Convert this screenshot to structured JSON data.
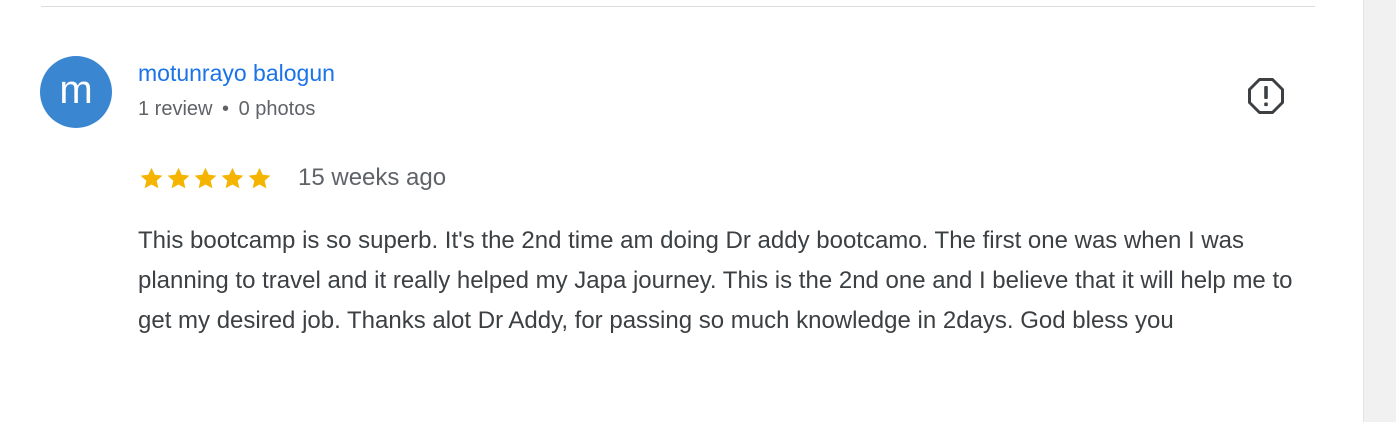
{
  "review": {
    "avatar_letter": "m",
    "avatar_color": "#3b86d1",
    "reviewer_name": "motunrayo balogun",
    "review_count": "1 review",
    "meta_separator": "•",
    "photo_count": "0 photos",
    "rating": 5,
    "rating_max": 5,
    "star_color": "#f4b400",
    "time_ago": "15 weeks ago",
    "text": "This bootcamp is so superb. It's the 2nd time am doing Dr addy bootcamo. The first one was when I was planning to travel and it really helped my Japa journey. This is the 2nd one and I believe that it will help me to get my desired job. Thanks alot Dr Addy, for passing so much knowledge in 2days. God bless you",
    "flag_icon": "report-icon"
  },
  "colors": {
    "link": "#1a73e8",
    "secondary_text": "#5f6368",
    "body_text": "#3c4043",
    "divider": "#dadce0"
  }
}
